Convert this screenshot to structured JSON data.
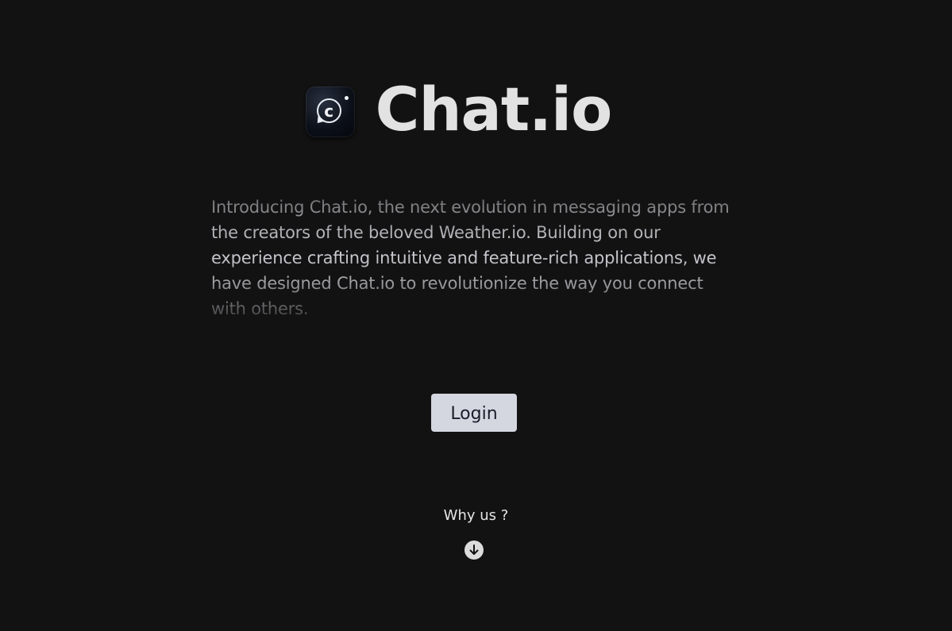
{
  "brand": {
    "title": "Chat.io",
    "logo_icon": "chat-bubble-c-icon",
    "logo_letter": "c"
  },
  "intro": {
    "text": "Introducing Chat.io, the next evolution in messaging apps from the creators of the beloved Weather.io. Building on our experience crafting intuitive and feature-rich applications, we have designed Chat.io to revolutionize the way you connect with others."
  },
  "actions": {
    "login_label": "Login",
    "why_us_label": "Why us ?",
    "scroll_icon": "arrow-down-circle-icon"
  },
  "colors": {
    "background": "#121212",
    "title": "#e2e2e2",
    "button_bg": "#d4d6e0",
    "button_text": "#1a1d2b"
  }
}
